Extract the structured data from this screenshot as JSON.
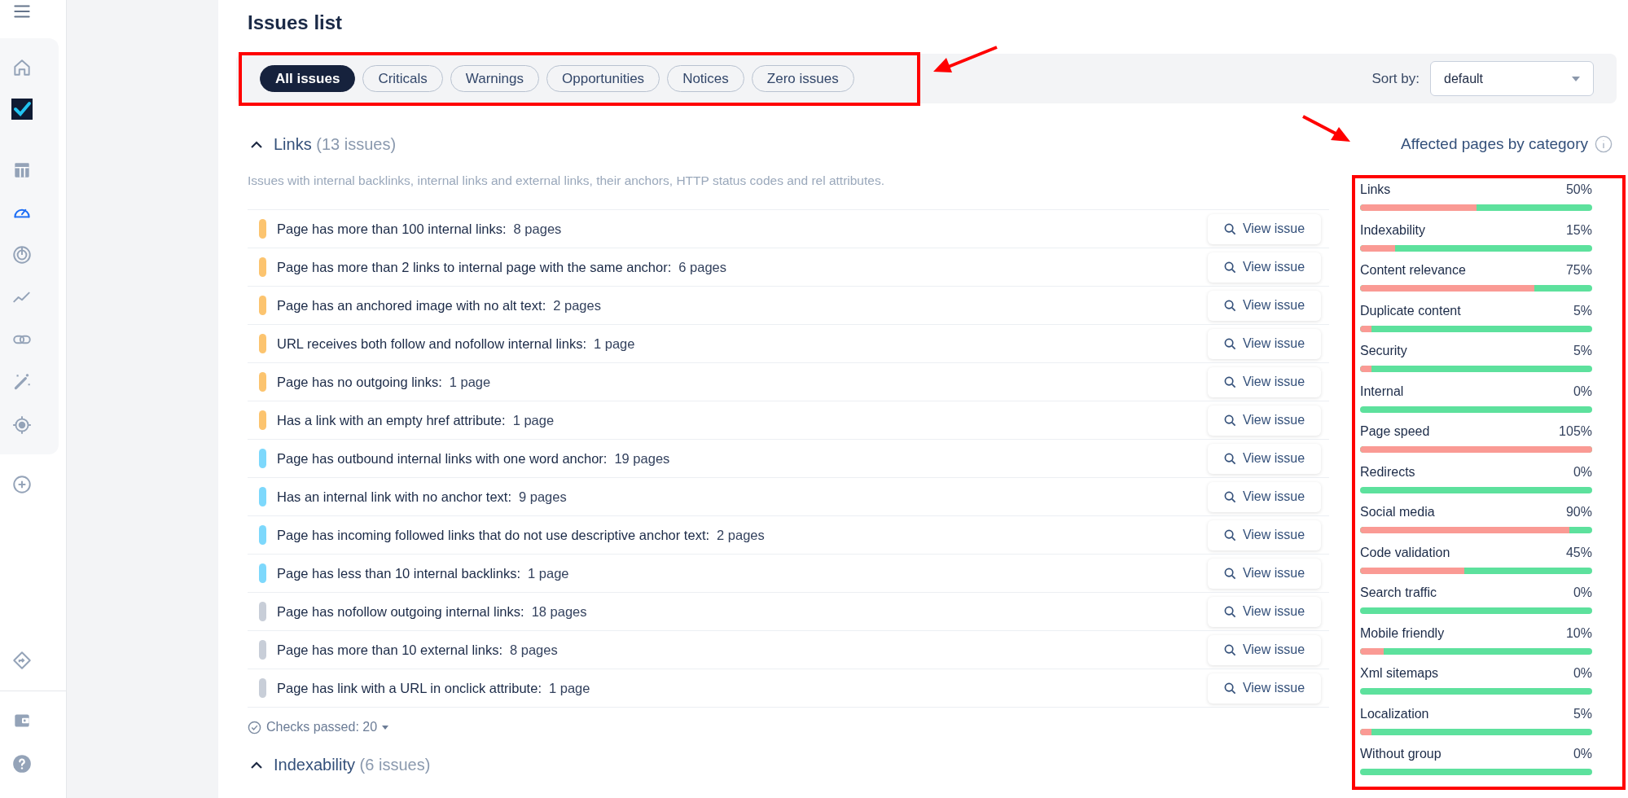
{
  "sidebar": {
    "items": [
      {
        "selected": false
      },
      {
        "selected": false
      },
      {
        "selected": false
      },
      {
        "selected": true
      },
      {
        "selected": false
      },
      {
        "selected": false
      },
      {
        "selected": false
      },
      {
        "selected": false
      },
      {
        "selected": false
      },
      {
        "selected": false
      },
      {
        "selected": false
      },
      {
        "selected": false
      },
      {
        "selected": false
      }
    ]
  },
  "page_title": "Issues list",
  "filters": [
    {
      "label": "All issues",
      "selected": true
    },
    {
      "label": "Criticals",
      "selected": false
    },
    {
      "label": "Warnings",
      "selected": false
    },
    {
      "label": "Opportunities",
      "selected": false
    },
    {
      "label": "Notices",
      "selected": false
    },
    {
      "label": "Zero issues",
      "selected": false
    }
  ],
  "sort": {
    "label": "Sort by:",
    "value": "default"
  },
  "sections": [
    {
      "title": "Links",
      "count": "(13 issues)",
      "expanded": true,
      "description": "Issues with internal backlinks, internal links and external links, their anchors, HTTP status codes and rel attributes.",
      "issues": [
        {
          "title": "Page has more than 100 internal links:",
          "pages": "8 pages",
          "color": "#fcc46f",
          "action": "View issue"
        },
        {
          "title": "Page has more than 2 links to internal page with the same anchor:",
          "pages": "6 pages",
          "color": "#fcc46f",
          "action": "View issue"
        },
        {
          "title": "Page has an anchored image with no alt text:",
          "pages": "2 pages",
          "color": "#fcc46f",
          "action": "View issue"
        },
        {
          "title": "URL receives both follow and nofollow internal links:",
          "pages": "1 page",
          "color": "#fcc46f",
          "action": "View issue"
        },
        {
          "title": "Page has no outgoing links:",
          "pages": "1 page",
          "color": "#fcc46f",
          "action": "View issue"
        },
        {
          "title": "Has a link with an empty href attribute:",
          "pages": "1 page",
          "color": "#fcc46f",
          "action": "View issue"
        },
        {
          "title": "Page has outbound internal links with one word anchor:",
          "pages": "19 pages",
          "color": "#7dd8fc",
          "action": "View issue"
        },
        {
          "title": "Has an internal link with no anchor text:",
          "pages": "9 pages",
          "color": "#7dd8fc",
          "action": "View issue"
        },
        {
          "title": "Page has incoming followed links that do not use descriptive anchor text:",
          "pages": "2 pages",
          "color": "#7dd8fc",
          "action": "View issue"
        },
        {
          "title": "Page has less than 10 internal backlinks:",
          "pages": "1 page",
          "color": "#7dd8fc",
          "action": "View issue"
        },
        {
          "title": "Page has nofollow outgoing internal links:",
          "pages": "18 pages",
          "color": "#c8ced8",
          "action": "View issue"
        },
        {
          "title": "Page has more than 10 external links:",
          "pages": "8 pages",
          "color": "#c8ced8",
          "action": "View issue"
        },
        {
          "title": "Page has link with a URL in onclick attribute:",
          "pages": "1 page",
          "color": "#c8ced8",
          "action": "View issue"
        }
      ],
      "checks_passed": "Checks passed: 20"
    },
    {
      "title": "Indexability",
      "count": "(6 issues)",
      "expanded": true
    }
  ],
  "affected": {
    "title": "Affected pages by category",
    "categories": [
      {
        "name": "Links",
        "value": "50%",
        "level": 0.5
      },
      {
        "name": "Indexability",
        "value": "15%",
        "level": 0.15
      },
      {
        "name": "Content relevance",
        "value": "75%",
        "level": 0.75
      },
      {
        "name": "Duplicate content",
        "value": "5%",
        "level": 0.05
      },
      {
        "name": "Security",
        "value": "5%",
        "level": 0.05
      },
      {
        "name": "Internal",
        "value": "0%",
        "level": 0
      },
      {
        "name": "Page speed",
        "value": "105%",
        "level": 1
      },
      {
        "name": "Redirects",
        "value": "0%",
        "level": 0
      },
      {
        "name": "Social media",
        "value": "90%",
        "level": 0.9
      },
      {
        "name": "Code validation",
        "value": "45%",
        "level": 0.45
      },
      {
        "name": "Search traffic",
        "value": "0%",
        "level": 0
      },
      {
        "name": "Mobile friendly",
        "value": "10%",
        "level": 0.1
      },
      {
        "name": "Xml sitemaps",
        "value": "0%",
        "level": 0
      },
      {
        "name": "Localization",
        "value": "5%",
        "level": 0.05
      },
      {
        "name": "Without group",
        "value": "0%",
        "level": 0
      }
    ]
  }
}
